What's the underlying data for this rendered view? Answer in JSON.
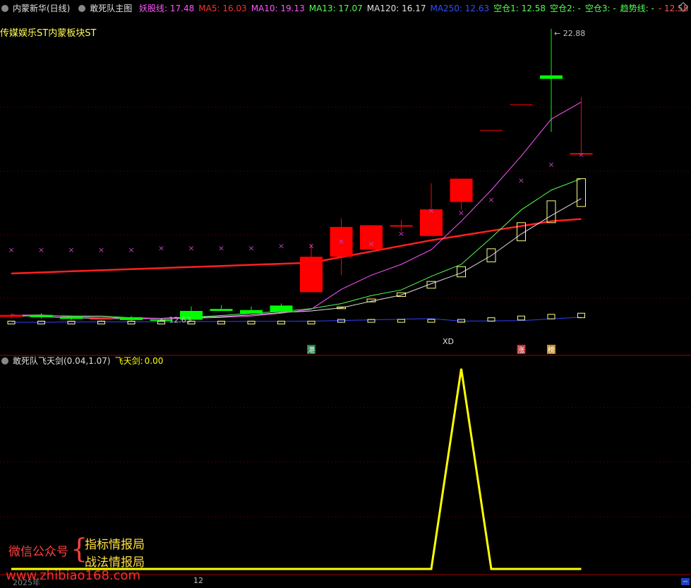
{
  "header": {
    "stock": "内蒙新华(日线)",
    "indicator": "敢死队主图",
    "items": [
      {
        "label": "妖股线:",
        "value": "17.48",
        "color": "#ff54ff"
      },
      {
        "label": "MA5:",
        "value": "16.03",
        "color": "#ff3030"
      },
      {
        "label": "MA10:",
        "value": "19.13",
        "color": "#ff54ff"
      },
      {
        "label": "MA13:",
        "value": "17.07",
        "color": "#54ff54"
      },
      {
        "label": "MA120:",
        "value": "16.17",
        "color": "#e0e0e0"
      },
      {
        "label": "MA250:",
        "value": "12.63",
        "color": "#3050ff"
      },
      {
        "label": "空仓1:",
        "value": "12.58",
        "color": "#54ff54"
      },
      {
        "label": "空仓2:",
        "value": "-",
        "color": "#54ff54"
      },
      {
        "label": "空仓3:",
        "value": "-",
        "color": "#54ff54"
      },
      {
        "label": "趋势线:",
        "value": "-",
        "color": "#54ff54"
      },
      {
        "label": "-",
        "value": "12.58",
        "color": "#ff5454"
      }
    ]
  },
  "sector_label": "传媒娱乐ST内蒙板块ST",
  "sub_header": {
    "indicator": "敢死队飞天剑(0.04,1.07)",
    "label": "飞天剑:",
    "value": "0.00"
  },
  "watermark": {
    "left": "微信公众号",
    "right_top": "指标情报局",
    "right_bottom": "战法情报局",
    "url": "www.zhibiao168.com"
  },
  "xaxis": {
    "left_label": "2025年",
    "tick_label": "12"
  },
  "chart_data": [
    {
      "type": "candlestick",
      "title": "敢死队主图",
      "ylim": [
        11.4,
        23.4
      ],
      "price_labels": {
        "high": "22.88",
        "low": "12.63"
      },
      "colors": {
        "up": "#ff0000",
        "down": "#00ff00",
        "ma_short": "#ff2020",
        "ma_long": "#3040ff",
        "ma_mid": "#54ff54",
        "yao": "#ff54ff",
        "marker": "#c040c0"
      },
      "candles": [
        {
          "o": 12.73,
          "c": 12.8,
          "h": 12.85,
          "l": 12.66
        },
        {
          "o": 12.8,
          "c": 12.72,
          "h": 12.86,
          "l": 12.68
        },
        {
          "o": 12.74,
          "c": 12.66,
          "h": 12.78,
          "l": 12.62
        },
        {
          "o": 12.66,
          "c": 12.68,
          "h": 12.74,
          "l": 12.6
        },
        {
          "o": 12.72,
          "c": 12.62,
          "h": 12.76,
          "l": 12.58
        },
        {
          "o": 12.64,
          "c": 12.6,
          "h": 12.68,
          "l": 12.56
        },
        {
          "o": 12.94,
          "c": 12.63,
          "h": 13.1,
          "l": 12.6
        },
        {
          "o": 13.01,
          "c": 12.94,
          "h": 13.15,
          "l": 12.94
        },
        {
          "o": 12.97,
          "c": 12.85,
          "h": 13.1,
          "l": 12.85
        },
        {
          "o": 13.13,
          "c": 12.9,
          "h": 13.2,
          "l": 12.88
        },
        {
          "o": 13.6,
          "c": 14.85,
          "h": 15.3,
          "l": 13.6
        },
        {
          "o": 14.85,
          "c": 15.9,
          "h": 16.2,
          "l": 14.2
        },
        {
          "o": 15.1,
          "c": 15.96,
          "h": 15.96,
          "l": 15.1
        },
        {
          "o": 15.96,
          "c": 15.96,
          "h": 16.15,
          "l": 15.75
        },
        {
          "o": 15.58,
          "c": 16.52,
          "h": 17.44,
          "l": 15.58
        },
        {
          "o": 16.78,
          "c": 17.6,
          "h": 17.6,
          "l": 16.52
        },
        {
          "o": 19.3,
          "c": 19.3,
          "h": 19.3,
          "l": 19.3
        },
        {
          "o": 20.2,
          "c": 20.2,
          "h": 20.2,
          "l": 20.2
        },
        {
          "o": 21.24,
          "c": 21.12,
          "h": 22.88,
          "l": 19.25
        },
        {
          "o": 18.5,
          "c": 18.5,
          "h": 20.48,
          "l": 18.5
        }
      ],
      "hollow_boxes": [
        {
          "lo": 12.5,
          "hi": 12.58
        },
        {
          "lo": 12.5,
          "hi": 12.58
        },
        {
          "lo": 12.5,
          "hi": 12.58
        },
        {
          "lo": 12.5,
          "hi": 12.58
        },
        {
          "lo": 12.5,
          "hi": 12.58
        },
        {
          "lo": 12.5,
          "hi": 12.58
        },
        {
          "lo": 12.5,
          "hi": 12.58
        },
        {
          "lo": 12.5,
          "hi": 12.58
        },
        {
          "lo": 12.5,
          "hi": 12.58
        },
        {
          "lo": 12.5,
          "hi": 12.58
        },
        {
          "lo": 12.5,
          "hi": 12.58
        },
        {
          "lo": 12.54,
          "hi": 12.64
        },
        {
          "lo": 12.54,
          "hi": 12.64
        },
        {
          "lo": 12.54,
          "hi": 12.64
        },
        {
          "lo": 12.54,
          "hi": 12.64
        },
        {
          "lo": 12.54,
          "hi": 12.64
        },
        {
          "lo": 12.58,
          "hi": 12.7
        },
        {
          "lo": 12.62,
          "hi": 12.76
        },
        {
          "lo": 12.66,
          "hi": 12.82
        },
        {
          "lo": 12.7,
          "hi": 12.86
        }
      ],
      "yellow_boxes": [
        null,
        null,
        null,
        null,
        null,
        null,
        null,
        null,
        null,
        null,
        null,
        {
          "lo": 13.02,
          "hi": 13.08
        },
        {
          "lo": 13.26,
          "hi": 13.36
        },
        {
          "lo": 13.45,
          "hi": 13.58
        },
        {
          "lo": 13.74,
          "hi": 13.98
        },
        {
          "lo": 14.14,
          "hi": 14.5
        },
        {
          "lo": 14.67,
          "hi": 15.13
        },
        {
          "lo": 15.41,
          "hi": 16.05
        },
        {
          "lo": 16.05,
          "hi": 16.82
        },
        {
          "lo": 16.62,
          "hi": 17.6
        }
      ],
      "x_markers": [
        15.1,
        15.1,
        15.1,
        15.1,
        15.1,
        15.17,
        15.17,
        15.17,
        15.17,
        15.24,
        15.24,
        15.4,
        15.31,
        15.67,
        16.48,
        16.41,
        16.86,
        17.55,
        18.11,
        18.46
      ],
      "ma_short": [
        14.26,
        null,
        null,
        null,
        null,
        null,
        null,
        null,
        null,
        null,
        14.64,
        null,
        null,
        null,
        15.43,
        null,
        null,
        null,
        16.1,
        16.18
      ],
      "ma_long": [
        12.54,
        null,
        null,
        null,
        null,
        null,
        null,
        null,
        null,
        null,
        12.58,
        null,
        null,
        null,
        12.67,
        12.58,
        null,
        12.6,
        null,
        12.72
      ],
      "ma_mid": [
        12.75,
        12.78,
        12.76,
        12.76,
        12.7,
        12.68,
        12.72,
        12.78,
        12.86,
        12.92,
        13.02,
        13.2,
        13.48,
        13.68,
        14.16,
        14.58,
        15.52,
        16.5,
        17.2,
        17.6
      ],
      "ma_white": [
        12.8,
        12.74,
        12.7,
        12.68,
        12.66,
        12.68,
        12.7,
        12.74,
        12.8,
        12.88,
        12.94,
        13.05,
        13.28,
        13.5,
        13.9,
        14.28,
        14.89,
        15.65,
        16.3,
        16.9
      ],
      "yao": [
        12.79,
        12.8,
        12.74,
        12.72,
        12.69,
        12.67,
        12.68,
        12.71,
        12.76,
        12.86,
        13.0,
        13.7,
        14.2,
        14.58,
        15.1,
        16.1,
        17.2,
        18.4,
        19.7,
        20.3
      ],
      "tags": [
        {
          "i": 10,
          "text": "港",
          "bg": "#208040"
        },
        {
          "i": 17,
          "text": "涨",
          "bg": "#c03030"
        },
        {
          "i": 18,
          "text": "榜",
          "bg": "#c09030"
        }
      ],
      "xd_label": "XD"
    },
    {
      "type": "line",
      "title": "敢死队飞天剑",
      "series": [
        {
          "name": "飞天剑",
          "color": "#ffff00",
          "values": [
            0,
            0,
            0,
            0,
            0,
            0,
            0,
            0,
            0,
            0,
            0,
            0,
            0,
            0,
            0,
            1,
            0,
            0,
            0,
            0
          ]
        }
      ],
      "ylim": [
        0,
        1.07
      ]
    }
  ]
}
